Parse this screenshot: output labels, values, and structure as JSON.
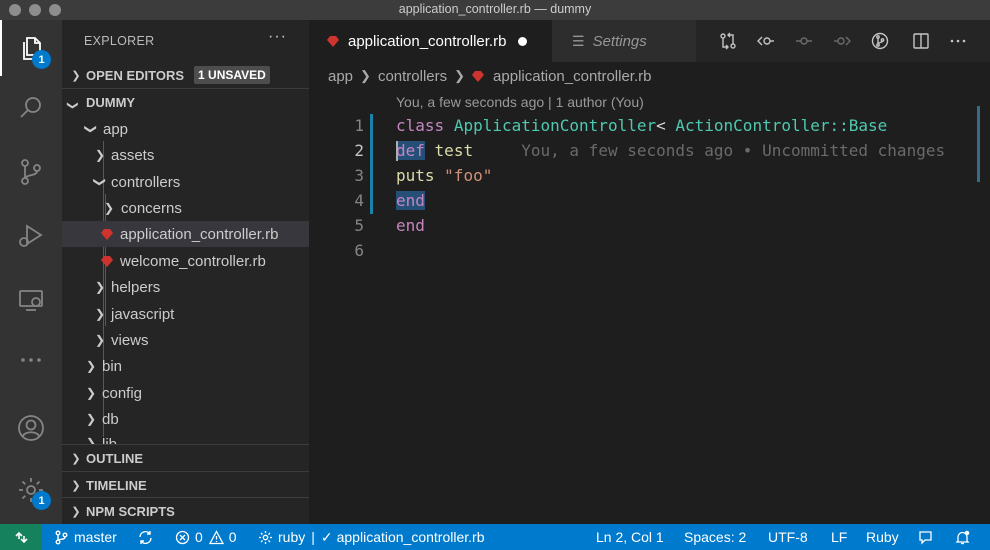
{
  "window": {
    "title": "application_controller.rb — dummy"
  },
  "activity": {
    "explorer_badge": "1",
    "settings_badge": "1"
  },
  "sidebar": {
    "title": "EXPLORER",
    "more": "···",
    "open_editors": {
      "label": "OPEN EDITORS",
      "badge": "1 UNSAVED"
    },
    "project": {
      "label": "DUMMY"
    },
    "tree": [
      {
        "label": "app",
        "type": "folder",
        "expanded": true
      },
      {
        "label": "assets",
        "type": "folder",
        "expanded": false
      },
      {
        "label": "controllers",
        "type": "folder",
        "expanded": true
      },
      {
        "label": "concerns",
        "type": "folder",
        "expanded": false
      },
      {
        "label": "application_controller.rb",
        "type": "file"
      },
      {
        "label": "welcome_controller.rb",
        "type": "file"
      },
      {
        "label": "helpers",
        "type": "folder",
        "expanded": false
      },
      {
        "label": "javascript",
        "type": "folder",
        "expanded": false
      },
      {
        "label": "views",
        "type": "folder",
        "expanded": false
      },
      {
        "label": "bin",
        "type": "folder",
        "expanded": false
      },
      {
        "label": "config",
        "type": "folder",
        "expanded": false
      },
      {
        "label": "db",
        "type": "folder",
        "expanded": false
      },
      {
        "label": "lib",
        "type": "folder",
        "expanded": false
      }
    ],
    "sections": {
      "outline": "OUTLINE",
      "timeline": "TIMELINE",
      "npm_scripts": "NPM SCRIPTS"
    }
  },
  "editor": {
    "tabs": [
      {
        "label": "application_controller.rb",
        "active": true,
        "dirty": true
      },
      {
        "label": "Settings",
        "active": false
      }
    ],
    "breadcrumb": [
      "app",
      "controllers",
      "application_controller.rb"
    ],
    "codelens": "You, a few seconds ago | 1 author (You)",
    "line_numbers": [
      "1",
      "2",
      "3",
      "4",
      "5",
      "6"
    ],
    "code": {
      "l1_kw": "class",
      "l1_cls": "ApplicationController",
      "l1_sep": "< ",
      "l1_base": "ActionController::Base",
      "l2_kw": "def",
      "l2_fn": "test",
      "l2_blame": "You, a few seconds ago • Uncommitted changes",
      "l3_fn": "puts",
      "l3_str": "\"foo\"",
      "l4_kw": "end",
      "l5_kw": "end"
    }
  },
  "statusbar": {
    "branch": "master",
    "errors": "0",
    "warnings": "0",
    "ruby_status": "ruby",
    "file_check": "application_controller.rb",
    "position": "Ln 2, Col 1",
    "spaces": "Spaces: 2",
    "encoding": "UTF-8",
    "eol": "LF",
    "language": "Ruby"
  },
  "colors": {
    "accent": "#007acc",
    "remote": "#16825d",
    "ruby_icon": "#cc342d"
  }
}
